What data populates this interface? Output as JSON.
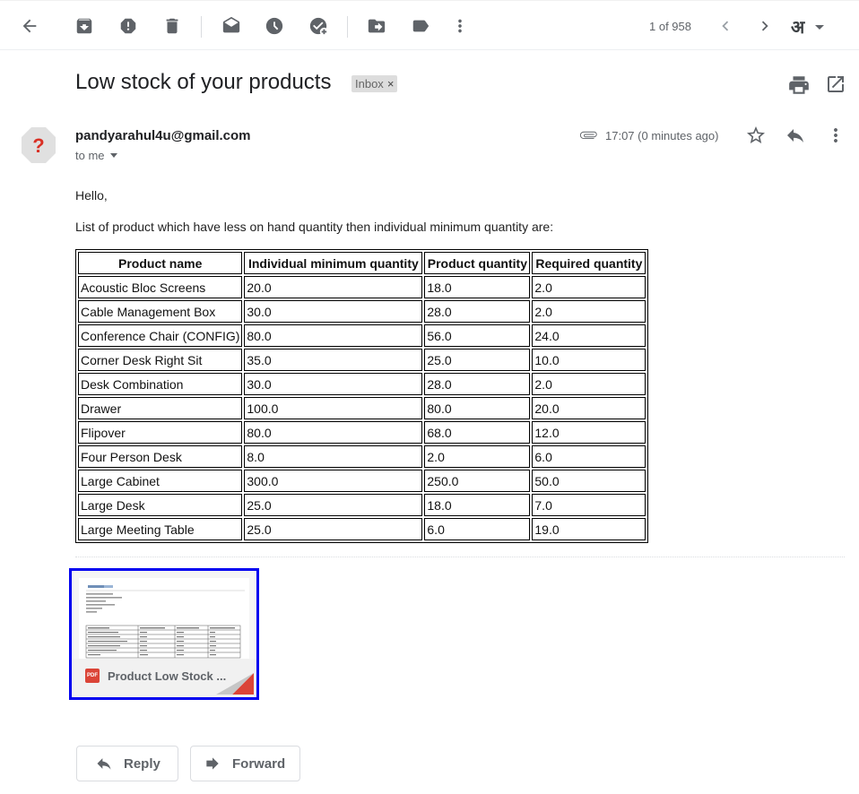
{
  "toolbar": {
    "pager_text": "1 of 958",
    "language_glyph": "अ",
    "icons": [
      "back-arrow-icon",
      "archive-icon",
      "report-spam-icon",
      "delete-icon",
      "mark-unread-icon",
      "snooze-icon",
      "add-to-tasks-icon",
      "move-to-icon",
      "labels-icon",
      "more-vert-icon",
      "chevron-left-icon",
      "chevron-right-icon"
    ]
  },
  "email": {
    "subject": "Low stock of your products",
    "label": "Inbox",
    "label_remove": "×",
    "sender": "pandyarahul4u@gmail.com",
    "recipient": "to me",
    "time": "17:07 (0 minutes ago)",
    "greeting": "Hello,",
    "intro": "List of product which have less on hand quantity then individual minimum quantity are:"
  },
  "table": {
    "headers": [
      "Product name",
      "Individual minimum quantity",
      "Product quantity",
      "Required quantity"
    ],
    "rows": [
      [
        "Acoustic Bloc Screens",
        "20.0",
        "18.0",
        "2.0"
      ],
      [
        "Cable Management Box",
        "30.0",
        "28.0",
        "2.0"
      ],
      [
        "Conference Chair (CONFIG)",
        "80.0",
        "56.0",
        "24.0"
      ],
      [
        "Corner Desk Right Sit",
        "35.0",
        "25.0",
        "10.0"
      ],
      [
        "Desk Combination",
        "30.0",
        "28.0",
        "2.0"
      ],
      [
        "Drawer",
        "100.0",
        "80.0",
        "20.0"
      ],
      [
        "Flipover",
        "80.0",
        "68.0",
        "12.0"
      ],
      [
        "Four Person Desk",
        "8.0",
        "2.0",
        "6.0"
      ],
      [
        "Large Cabinet",
        "300.0",
        "250.0",
        "50.0"
      ],
      [
        "Large Desk",
        "25.0",
        "18.0",
        "7.0"
      ],
      [
        "Large Meeting Table",
        "25.0",
        "6.0",
        "19.0"
      ]
    ]
  },
  "attachment": {
    "type_badge": "PDF",
    "name": "Product Low Stock ..."
  },
  "actions": {
    "reply_label": "Reply",
    "forward_label": "Forward"
  },
  "colors": {
    "icon_grey": "#5f6368",
    "pdf_red": "#db4437",
    "attachment_focus_border": "#0000f0",
    "avatar_red": "#d93025"
  }
}
